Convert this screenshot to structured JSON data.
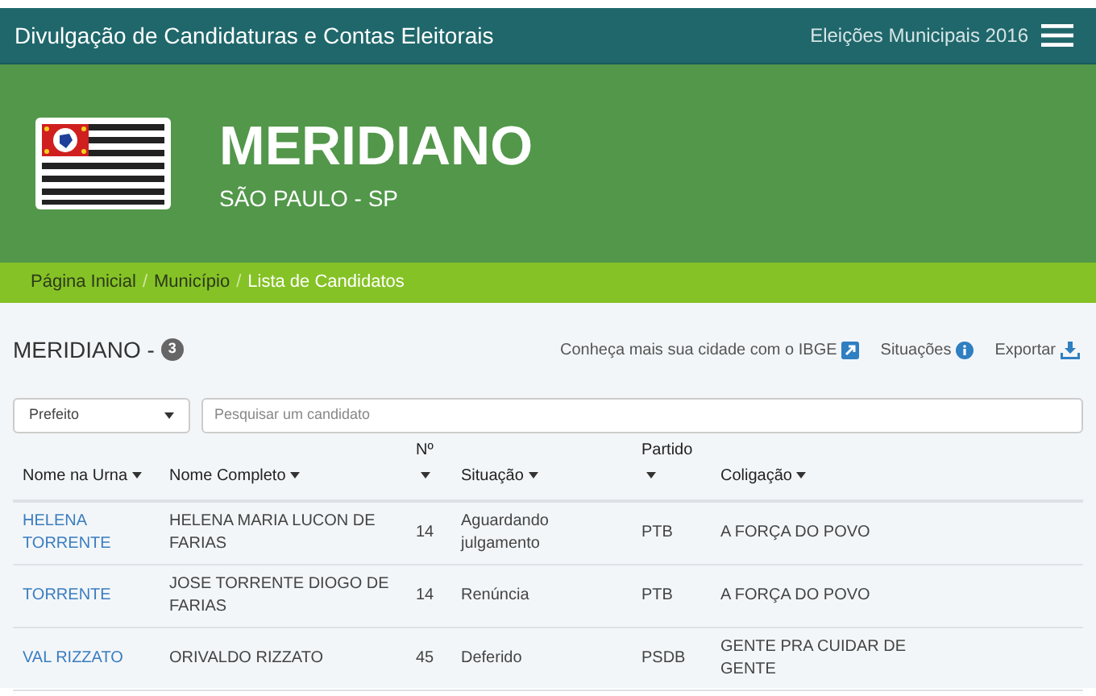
{
  "header": {
    "title": "Divulgação de Candidaturas e Contas Eleitorais",
    "election": "Eleições Municipais 2016"
  },
  "banner": {
    "city": "MERIDIANO",
    "state": "SÃO PAULO - SP"
  },
  "breadcrumb": [
    {
      "label": "Página Inicial",
      "selected": false
    },
    {
      "label": "Município",
      "selected": false
    },
    {
      "label": "Lista de Candidatos",
      "selected": true
    }
  ],
  "breadcrumb_separator": "/",
  "list_title": "MERIDIANO -",
  "count": "3",
  "actions": [
    {
      "label": "Conheça mais sua cidade com o IBGE",
      "kind": "external"
    },
    {
      "label": "Situações",
      "kind": "info"
    },
    {
      "label": "Exportar",
      "kind": "download"
    }
  ],
  "filter": {
    "value": "Prefeito"
  },
  "search": {
    "placeholder": "Pesquisar um candidato"
  },
  "table": {
    "columns": [
      "Nome na Urna",
      "Nome Completo",
      "Nº",
      "Situação",
      "Partido",
      "Coligação"
    ],
    "rows": [
      [
        "HELENA TORRENTE",
        "HELENA MARIA LUCON DE FARIAS",
        "14",
        "Aguardando julgamento",
        "PTB",
        "A FORÇA DO POVO"
      ],
      [
        "TORRENTE",
        "JOSE TORRENTE DIOGO DE FARIAS",
        "14",
        "Renúncia",
        "PTB",
        "A FORÇA DO POVO"
      ],
      [
        "VAL RIZZATO",
        "ORIVALDO RIZZATO",
        "45",
        "Deferido",
        "PSDB",
        "GENTE PRA CUIDAR DE GENTE"
      ]
    ]
  }
}
